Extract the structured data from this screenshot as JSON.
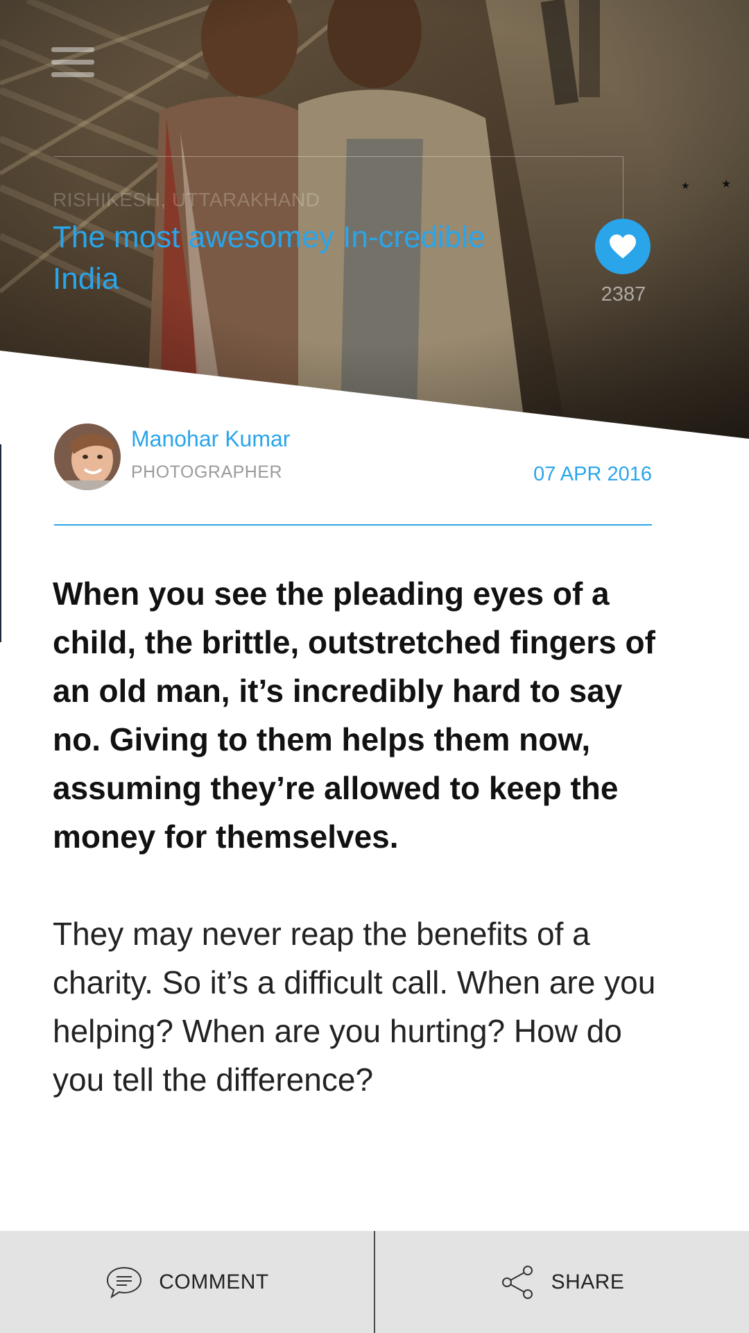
{
  "hero": {
    "location": "RISHIKESH, UTTARAKHAND",
    "title": "The most awesomey In-credible\n India",
    "like_count": "2387"
  },
  "author": {
    "name": "Manohar Kumar",
    "role": "PHOTOGRAPHER",
    "date": "07 APR 2016"
  },
  "article": {
    "lead": "When you see the pleading eyes of a child, the brittle, outstretched fingers of an old man, it’s incredibly hard to say no. Giving to them helps them now, assuming they’re allowed to keep the money for themselves.",
    "body": "They may never reap the benefits of a charity. So it’s a difficult call. When are you helping? When are you hurting? How do you tell the difference?"
  },
  "bottom_bar": {
    "comment_label": "COMMENT",
    "share_label": "SHARE"
  },
  "icons": {
    "menu": "hamburger-menu-icon",
    "like": "heart-icon",
    "comment": "comment-bubble-icon",
    "share": "share-icon"
  },
  "colors": {
    "accent": "#2aa5ea",
    "bottom_bar_bg": "#e3e3e3",
    "text_dark": "#111111",
    "text_muted": "#9a9a9a"
  }
}
